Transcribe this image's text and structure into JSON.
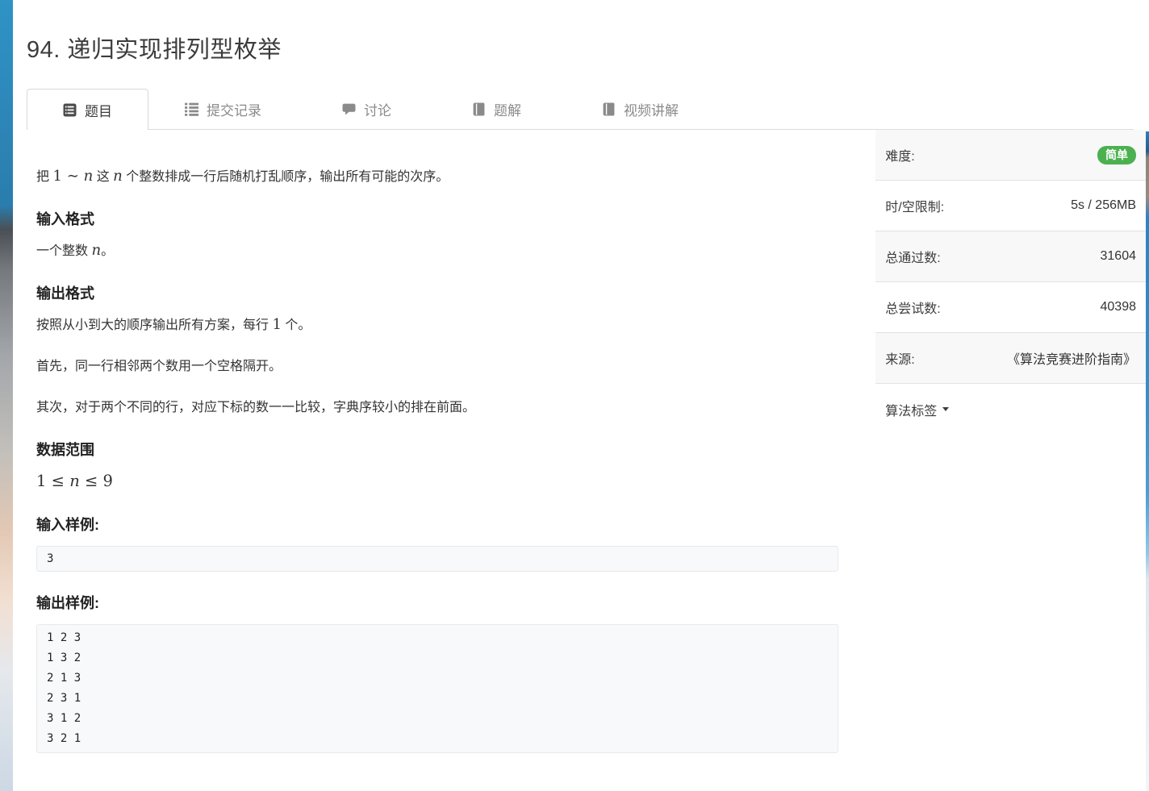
{
  "page": {
    "title": "94. 递归实现排列型枚举"
  },
  "tabs": [
    {
      "label": "题目"
    },
    {
      "label": "提交记录"
    },
    {
      "label": "讨论"
    },
    {
      "label": "题解"
    },
    {
      "label": "视频讲解"
    }
  ],
  "problem": {
    "intro": {
      "t1": "把 ",
      "m1": "1 ∼ ",
      "m2": "n",
      "t2": " 这 ",
      "m3": "n",
      "t3": " 个整数排成一行后随机打乱顺序，输出所有可能的次序。"
    },
    "input_format": {
      "heading": "输入格式",
      "t1": "一个整数 ",
      "m1": "n",
      "t2": "。"
    },
    "output_format": {
      "heading": "输出格式",
      "p1_t1": "按照从小到大的顺序输出所有方案，每行 ",
      "p1_m1": "1",
      "p1_t2": " 个。",
      "p2": "首先，同一行相邻两个数用一个空格隔开。",
      "p3": "其次，对于两个不同的行，对应下标的数一一比较，字典序较小的排在前面。"
    },
    "data_range": {
      "heading": "数据范围",
      "m1": "1 ≤ ",
      "m2": "n",
      "m3": " ≤ 9"
    },
    "samples": {
      "input_heading": "输入样例:",
      "input_code": "3",
      "output_heading": "输出样例:",
      "output_code": "1 2 3\n1 3 2\n2 1 3\n2 3 1\n3 1 2\n3 2 1"
    }
  },
  "sidebar": {
    "difficulty": {
      "label": "难度:",
      "value": "简单"
    },
    "limits": {
      "label": "时/空限制:",
      "value": "5s / 256MB"
    },
    "accepted": {
      "label": "总通过数:",
      "value": "31604"
    },
    "attempts": {
      "label": "总尝试数:",
      "value": "40398"
    },
    "source": {
      "label": "来源:",
      "value": "《算法竞赛进阶指南》"
    },
    "tags": {
      "label": "算法标签"
    }
  },
  "colors": {
    "difficulty_badge_green": "#4cb050",
    "background_sky_blue": "#2f93c6"
  }
}
